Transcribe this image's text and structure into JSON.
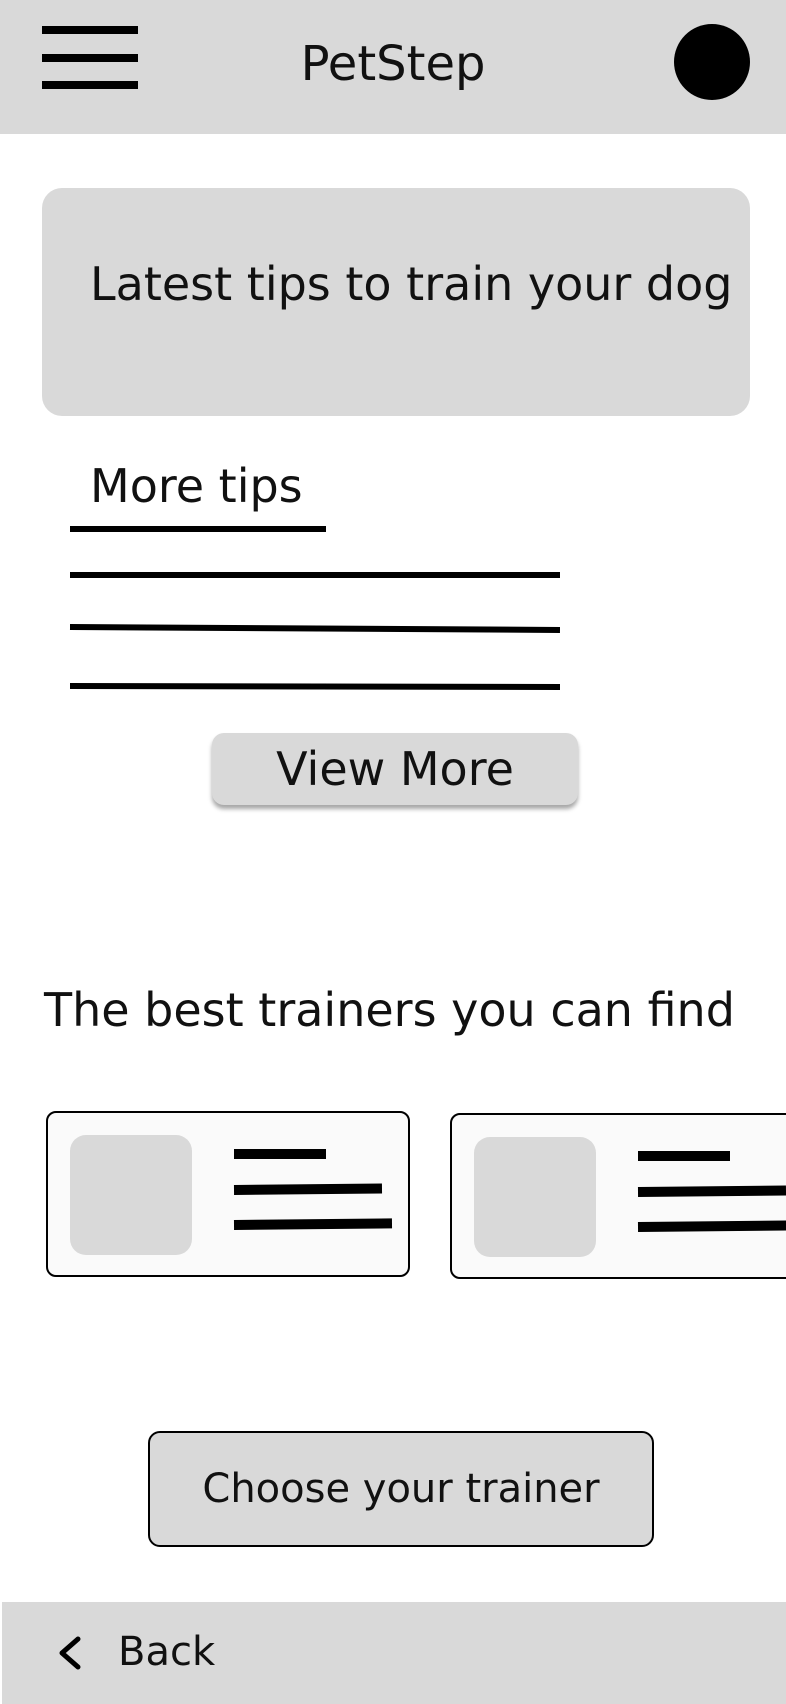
{
  "header": {
    "title": "PetStep",
    "menu_icon": "hamburger-menu-icon",
    "avatar_icon": "user-avatar"
  },
  "tips": {
    "banner_text": "Latest tips to train your dog",
    "more_label": "More tips",
    "view_more_label": "View More"
  },
  "trainers": {
    "heading": "The best trainers you can find",
    "cards": [
      {
        "photo": "image-placeholder"
      },
      {
        "photo": "image-placeholder"
      }
    ],
    "choose_label": "Choose your trainer"
  },
  "footer": {
    "back_label": "Back",
    "back_icon": "chevron-left-icon"
  },
  "colors": {
    "surface": "#d9d9d9",
    "background": "#ffffff",
    "ink": "#000000"
  }
}
